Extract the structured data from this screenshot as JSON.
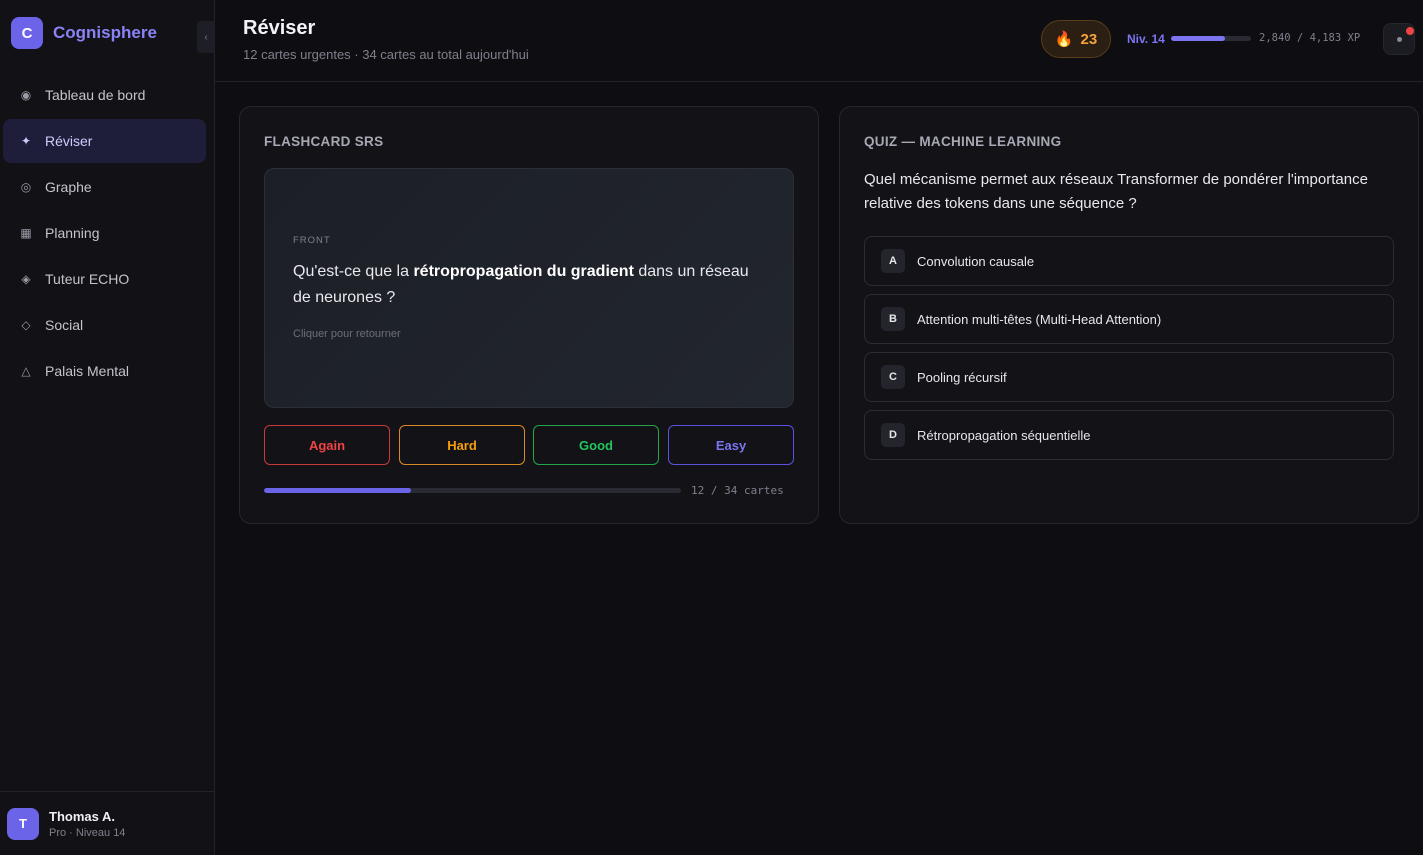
{
  "brand": {
    "logo_letter": "C",
    "name": "Cognisphere",
    "collapse_glyph": "‹"
  },
  "sidebar": {
    "items": [
      {
        "icon": "◉",
        "icon_name": "dashboard-icon",
        "label": "Tableau de bord",
        "active": false
      },
      {
        "icon": "✦",
        "icon_name": "sparkle-icon",
        "label": "Réviser",
        "active": true
      },
      {
        "icon": "◎",
        "icon_name": "graph-icon",
        "label": "Graphe",
        "active": false
      },
      {
        "icon": "▦",
        "icon_name": "calendar-grid-icon",
        "label": "Planning",
        "active": false
      },
      {
        "icon": "◈",
        "icon_name": "diamond-icon",
        "label": "Tuteur ECHO",
        "active": false
      },
      {
        "icon": "◇",
        "icon_name": "diamond-outline-icon",
        "label": "Social",
        "active": false
      },
      {
        "icon": "△",
        "icon_name": "triangle-icon",
        "label": "Palais Mental",
        "active": false
      }
    ]
  },
  "user": {
    "avatar_letter": "T",
    "name": "Thomas A.",
    "subtitle": "Pro · Niveau 14"
  },
  "header": {
    "title": "Réviser",
    "subtitle": "12 cartes urgentes · 34 cartes au total aujourd'hui",
    "streak": {
      "icon": "🔥",
      "count": "23"
    },
    "level": "Niv. 14",
    "xp": {
      "current": 2840,
      "max": 4183,
      "text": "2,840 / 4,183 XP"
    }
  },
  "flashcard": {
    "section_title": "FLASHCARD SRS",
    "side_label": "FRONT",
    "question_before": "Qu'est-ce que la ",
    "question_bold": "rétropropagation du gradient",
    "question_after": " dans un réseau de neurones ?",
    "hint": "Cliquer pour retourner",
    "buttons": {
      "again": "Again",
      "hard": "Hard",
      "good": "Good",
      "easy": "Easy"
    },
    "progress": {
      "done": 12,
      "total": 34,
      "text": "12 / 34 cartes"
    }
  },
  "quiz": {
    "section_title": "QUIZ — MACHINE LEARNING",
    "question": "Quel mécanisme permet aux réseaux Transformer de pondérer l'importance relative des tokens dans une séquence ?",
    "options": [
      {
        "letter": "A",
        "text": "Convolution causale"
      },
      {
        "letter": "B",
        "text": "Attention multi-têtes (Multi-Head Attention)"
      },
      {
        "letter": "C",
        "text": "Pooling récursif"
      },
      {
        "letter": "D",
        "text": "Rétropropagation séquentielle"
      }
    ]
  },
  "colors": {
    "accent": "#6b63e8",
    "again": "#ef4444",
    "hard": "#f59e0b",
    "good": "#22c55e",
    "easy": "#7c74f0"
  }
}
